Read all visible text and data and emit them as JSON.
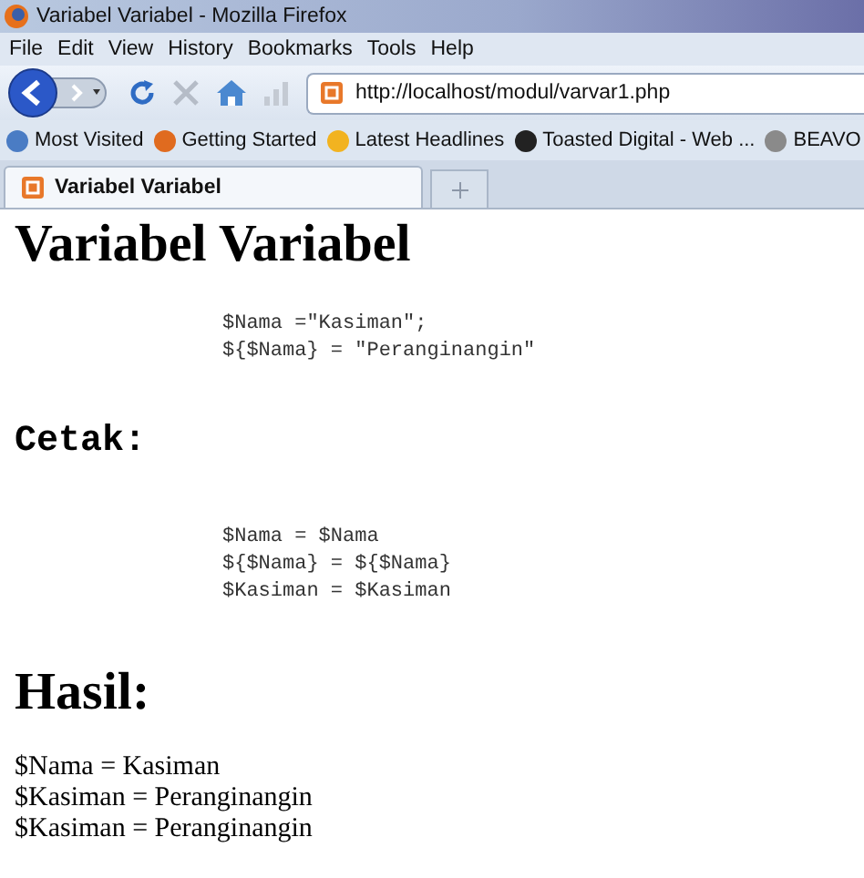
{
  "window": {
    "title": "Variabel Variabel - Mozilla Firefox"
  },
  "menu": [
    "File",
    "Edit",
    "View",
    "History",
    "Bookmarks",
    "Tools",
    "Help"
  ],
  "address": {
    "value": "http://localhost/modul/varvar1.php"
  },
  "bookmarks": [
    "Most Visited",
    "Getting Started",
    "Latest Headlines",
    "Toasted Digital - Web ...",
    "BEAVO"
  ],
  "tabs": [
    {
      "label": "Variabel Variabel",
      "selected": true
    }
  ],
  "page": {
    "heading": "Variabel Variabel",
    "code_1": [
      "$Nama =\"Kasiman\";",
      "${$Nama} = \"Peranginangin\""
    ],
    "heading_2": "Cetak:",
    "code_2": [
      "$Nama = $Nama",
      "${$Nama} = ${$Nama}",
      "$Kasiman = $Kasiman"
    ],
    "heading_3": "Hasil:",
    "results": [
      "$Nama = Kasiman",
      "$Kasiman = Peranginangin",
      "$Kasiman = Peranginangin"
    ]
  }
}
